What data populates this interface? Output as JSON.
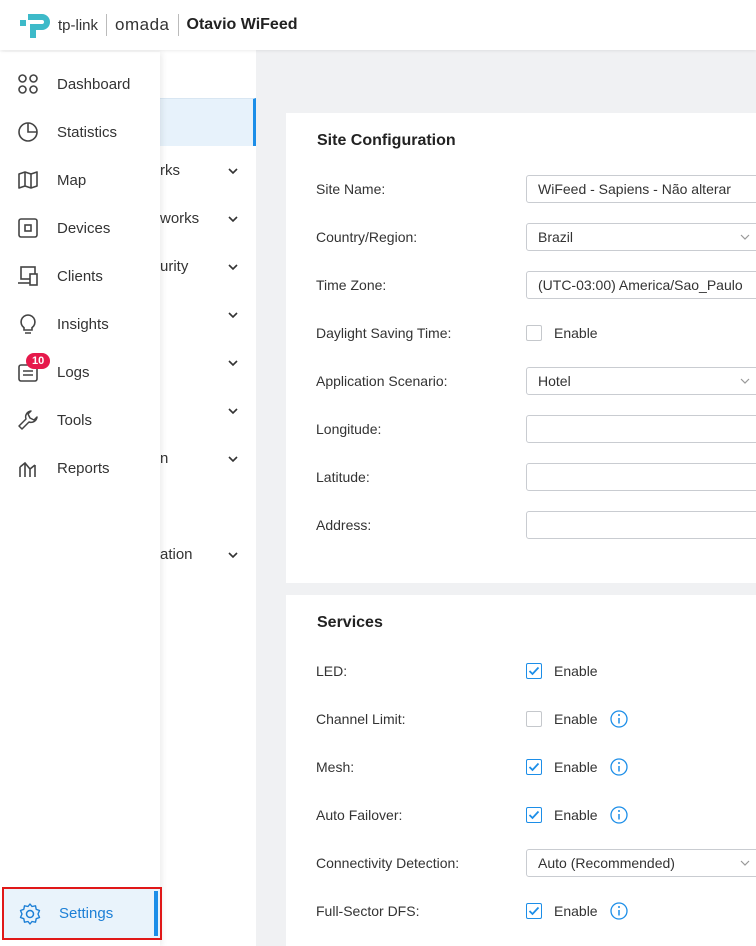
{
  "header": {
    "brand": "tp-link",
    "product": "omada",
    "site_name": "Otavio WiFeed"
  },
  "sidebar": {
    "items": [
      {
        "label": "Dashboard",
        "icon": "dashboard-icon"
      },
      {
        "label": "Statistics",
        "icon": "statistics-icon"
      },
      {
        "label": "Map",
        "icon": "map-icon"
      },
      {
        "label": "Devices",
        "icon": "devices-icon"
      },
      {
        "label": "Clients",
        "icon": "clients-icon"
      },
      {
        "label": "Insights",
        "icon": "insights-icon"
      },
      {
        "label": "Logs",
        "icon": "logs-icon",
        "badge": "10"
      },
      {
        "label": "Tools",
        "icon": "tools-icon"
      },
      {
        "label": "Reports",
        "icon": "reports-icon"
      }
    ],
    "settings": {
      "label": "Settings",
      "icon": "gear-icon",
      "active": true
    }
  },
  "subnav": {
    "partial_items": [
      "rks",
      "works",
      "urity",
      "n",
      "ation"
    ]
  },
  "site_config": {
    "title": "Site Configuration",
    "site_name": {
      "label": "Site Name",
      "value": "WiFeed - Sapiens - Não alterar"
    },
    "country": {
      "label": "Country/Region",
      "value": "Brazil"
    },
    "time_zone": {
      "label": "Time Zone",
      "value": "(UTC-03:00) America/Sao_Paulo"
    },
    "dst": {
      "label": "Daylight Saving Time",
      "option": "Enable",
      "checked": false
    },
    "scenario": {
      "label": "Application Scenario",
      "value": "Hotel"
    },
    "longitude": {
      "label": "Longitude",
      "value": ""
    },
    "latitude": {
      "label": "Latitude",
      "value": ""
    },
    "address": {
      "label": "Address",
      "value": ""
    }
  },
  "services": {
    "title": "Services",
    "led": {
      "label": "LED",
      "option": "Enable",
      "checked": true
    },
    "channel_limit": {
      "label": "Channel Limit",
      "option": "Enable",
      "checked": false
    },
    "mesh": {
      "label": "Mesh",
      "option": "Enable",
      "checked": true
    },
    "auto_failover": {
      "label": "Auto Failover",
      "option": "Enable",
      "checked": true
    },
    "connectivity": {
      "label": "Connectivity Detection",
      "value": "Auto (Recommended)"
    },
    "full_sector_dfs": {
      "label": "Full-Sector DFS",
      "option": "Enable",
      "checked": true
    }
  },
  "colors": {
    "accent": "#1c8ee8",
    "badge": "#e6194b",
    "highlight_border": "#e01818"
  }
}
